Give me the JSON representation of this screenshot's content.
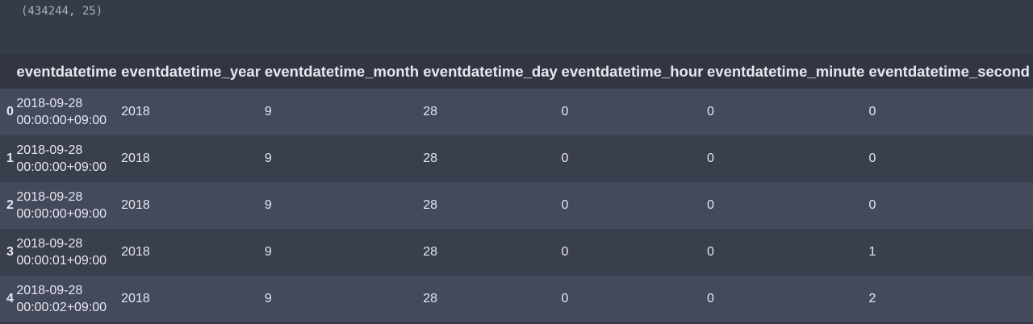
{
  "output": {
    "shape": "(434244, 25)"
  },
  "table": {
    "columns": [
      "eventdatetime",
      "eventdatetime_year",
      "eventdatetime_month",
      "eventdatetime_day",
      "eventdatetime_hour",
      "eventdatetime_minute",
      "eventdatetime_second"
    ],
    "rows": [
      {
        "index": "0",
        "date": "2018-09-28",
        "time": "00:00:00+09:00",
        "year": "2018",
        "month": "9",
        "day": "28",
        "hour": "0",
        "minute": "0",
        "second": "0"
      },
      {
        "index": "1",
        "date": "2018-09-28",
        "time": "00:00:00+09:00",
        "year": "2018",
        "month": "9",
        "day": "28",
        "hour": "0",
        "minute": "0",
        "second": "0"
      },
      {
        "index": "2",
        "date": "2018-09-28",
        "time": "00:00:00+09:00",
        "year": "2018",
        "month": "9",
        "day": "28",
        "hour": "0",
        "minute": "0",
        "second": "0"
      },
      {
        "index": "3",
        "date": "2018-09-28",
        "time": "00:00:01+09:00",
        "year": "2018",
        "month": "9",
        "day": "28",
        "hour": "0",
        "minute": "0",
        "second": "1"
      },
      {
        "index": "4",
        "date": "2018-09-28",
        "time": "00:00:02+09:00",
        "year": "2018",
        "month": "9",
        "day": "28",
        "hour": "0",
        "minute": "0",
        "second": "2"
      }
    ]
  }
}
